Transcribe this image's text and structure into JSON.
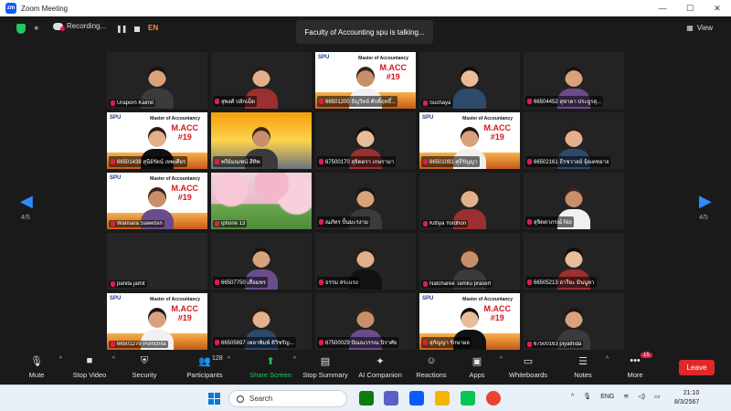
{
  "window": {
    "title": "Zoom Meeting",
    "minimize": "—",
    "maximize": "☐",
    "close": "✕"
  },
  "meeting_bar": {
    "recording_label": "Recording...",
    "pause_icon": "pause-icon",
    "stop_icon": "stop-icon",
    "language_label": "EN",
    "view_label": "View"
  },
  "talking_banner": "Faculty of Accounting spu is talking...",
  "pagination": {
    "left": "4/5",
    "right": "4/5"
  },
  "slide": {
    "school": "SPU",
    "program": "Master of Accountancy",
    "code": "M.ACC",
    "cohort": "#19"
  },
  "participants": [
    {
      "name": "Uraporn Kaimit",
      "kind": "person"
    },
    {
      "name": "สุพงศ์ ปลักเม็ด",
      "kind": "person"
    },
    {
      "name": "66501200 ธัญวิทย์ ศักดิ์ฤทธิ์...",
      "kind": "slide"
    },
    {
      "name": "Suchaya",
      "kind": "person"
    },
    {
      "name": "66504452 สุชาดา ประยูรสุ...",
      "kind": "person"
    },
    {
      "name": "66501438 สุนีย์รัตน์ เทพเศียร",
      "kind": "slide"
    },
    {
      "name": "พรีย์มณฑน์ สีทิพ",
      "kind": "sunset"
    },
    {
      "name": "67500170 สุจิตตรา เกษรามา",
      "kind": "person"
    },
    {
      "name": "66501091 ศุจีรัญญา",
      "kind": "slide"
    },
    {
      "name": "66502161 ธีรชวาลย์ จุ้ยเดชอาจ",
      "kind": "person"
    },
    {
      "name": "Warisara Sawetsin",
      "kind": "slide"
    },
    {
      "name": "iphone 13",
      "kind": "blossom"
    },
    {
      "name": "ณภัทร ปั้นมะรงาม",
      "kind": "person"
    },
    {
      "name": "Kittiya Yordhon",
      "kind": "person"
    },
    {
      "name": "สุจิตตาภรณ์ Noi",
      "kind": "person"
    },
    {
      "name": "panita jamit",
      "kind": "dark"
    },
    {
      "name": "66507750 เสื่อมพร",
      "kind": "person"
    },
    {
      "name": "ธรรม สระแรง",
      "kind": "person"
    },
    {
      "name": "Natcharee Tamku prasert",
      "kind": "person"
    },
    {
      "name": "66505213 ฮารียะ มินนูหา",
      "kind": "person"
    },
    {
      "name": "66501279 Pornchita",
      "kind": "slide"
    },
    {
      "name": "66505697 เพลาพิมพ์ ติวิชรัญ...",
      "kind": "person"
    },
    {
      "name": "67500029 ปัณณวรรณ นิราศัย",
      "kind": "person"
    },
    {
      "name": "สุกัญญา รักษาผล",
      "kind": "slide"
    },
    {
      "name": "67500163 piyathida",
      "kind": "person"
    }
  ],
  "toolbar": {
    "mute": "Mute",
    "stop_video": "Stop Video",
    "security": "Security",
    "participants": "Participants",
    "participants_count": "128",
    "share_screen": "Share Screen",
    "stop_summary": "Stop Summary",
    "ai_companion": "AI Companion",
    "reactions": "Reactions",
    "apps": "Apps",
    "whiteboards": "Whiteboards",
    "notes": "Notes",
    "more": "More",
    "more_badge": "15",
    "leave": "Leave"
  },
  "taskbar": {
    "search_placeholder": "Search",
    "tray_lang": "ENG",
    "time": "21:10",
    "date": "8/3/2567"
  }
}
